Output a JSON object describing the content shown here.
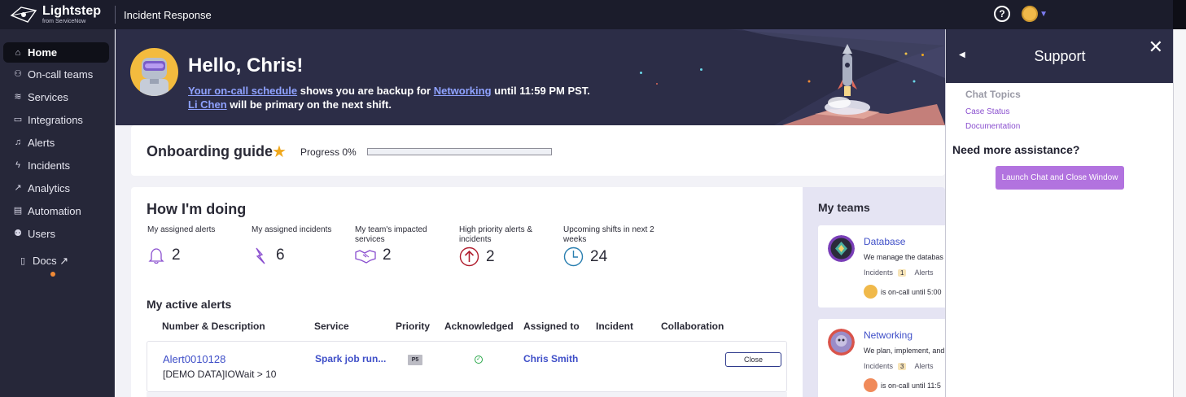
{
  "topbar": {
    "brand": "Lightstep",
    "brand_sub": "from ServiceNow",
    "app_title": "Incident Response",
    "help_icon": "help-circle-icon"
  },
  "sidebar": {
    "items": [
      {
        "label": "Home",
        "icon": "home-icon",
        "active": true
      },
      {
        "label": "On-call teams",
        "icon": "people-icon"
      },
      {
        "label": "Services",
        "icon": "services-icon"
      },
      {
        "label": "Integrations",
        "icon": "calendar-icon"
      },
      {
        "label": "Alerts",
        "icon": "bell-icon"
      },
      {
        "label": "Incidents",
        "icon": "bolt-icon"
      },
      {
        "label": "Analytics",
        "icon": "chart-icon"
      },
      {
        "label": "Automation",
        "icon": "automation-icon"
      },
      {
        "label": "Users",
        "icon": "users-icon"
      },
      {
        "label": "Docs ↗",
        "icon": "document-icon"
      }
    ]
  },
  "hero": {
    "greeting": "Hello, Chris!",
    "schedule_link": "Your on-call schedule",
    "backup_text": " shows you are backup for ",
    "team_link": "Networking",
    "until_text": " until 11:59 PM PST.",
    "primary_link": "Li Chen",
    "primary_text": " will be primary on the next shift."
  },
  "onboarding": {
    "title": "Onboarding guide",
    "progress_label": "Progress 0%",
    "progress": 0
  },
  "doing": {
    "title": "How I'm doing",
    "metrics": [
      {
        "label": "My assigned alerts",
        "value": "2",
        "icon": "bell-icon"
      },
      {
        "label": "My assigned incidents",
        "value": "6",
        "icon": "bolt-icon"
      },
      {
        "label": "My team's impacted services",
        "value": "2",
        "icon": "handshake-icon"
      },
      {
        "label": "High priority alerts & incidents",
        "value": "2",
        "icon": "arrow-up-circle-icon"
      },
      {
        "label": "Upcoming shifts in next 2 weeks",
        "value": "24",
        "icon": "clock-icon"
      }
    ]
  },
  "alerts": {
    "title": "My active alerts",
    "columns": [
      "Number & Description",
      "Service",
      "Priority",
      "Acknowledged",
      "Assigned to",
      "Incident",
      "Collaboration"
    ],
    "rows": [
      {
        "number": "Alert0010128",
        "description": "[DEMO DATA]IOWait > 10",
        "service": "Spark job run...",
        "priority": "P5",
        "acknowledged_icon": "check-circle-icon",
        "assigned_to": "Chris Smith",
        "action": "Close"
      }
    ]
  },
  "teams": {
    "title": "My teams",
    "items": [
      {
        "name": "Database",
        "description": "We manage the databas",
        "incidents_label": "Incidents",
        "incidents_count": "1",
        "alerts_label": "Alerts",
        "oncall_text": "is on-call until 5:00"
      },
      {
        "name": "Networking",
        "description": "We plan, implement, and",
        "incidents_label": "Incidents",
        "incidents_count": "3",
        "alerts_label": "Alerts",
        "oncall_text": "is on-call until 11:5"
      }
    ]
  },
  "support": {
    "title": "Support",
    "chat_topics": "Chat Topics",
    "links": [
      "Case Status",
      "Documentation"
    ],
    "need_help": "Need more assistance?",
    "launch_button": "Launch Chat and Close Window"
  }
}
